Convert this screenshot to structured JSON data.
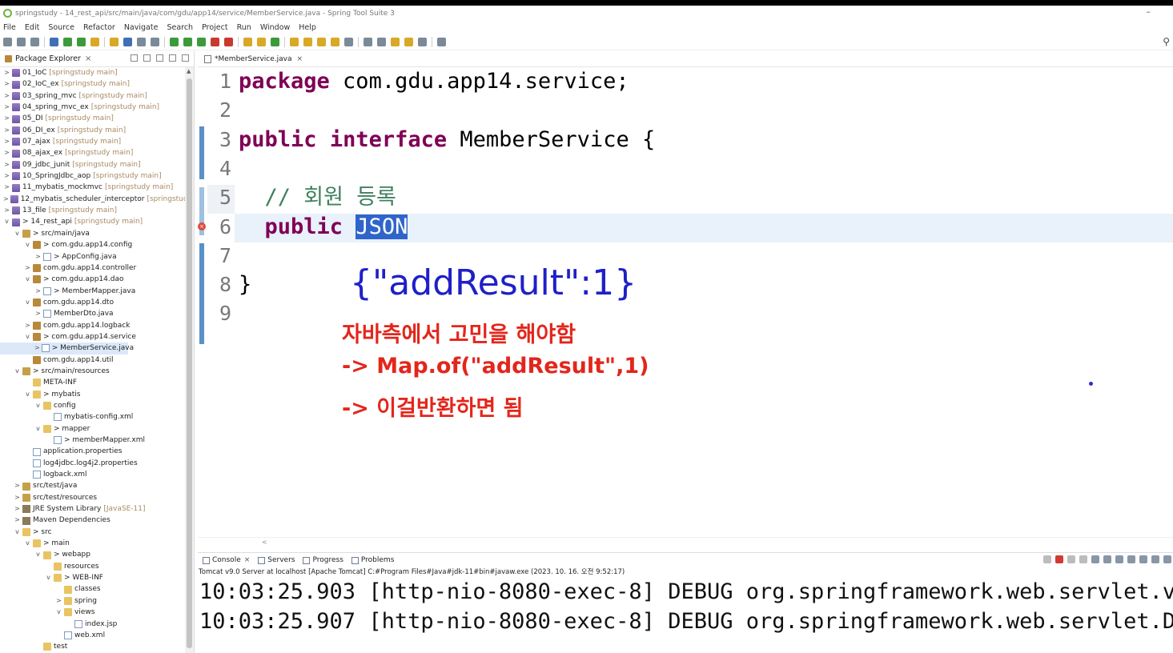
{
  "window": {
    "title": "springstudy - 14_rest_api/src/main/java/com/gdu/app14/service/MemberService.java - Spring Tool Suite 3",
    "minimize": "–"
  },
  "menu": [
    "File",
    "Edit",
    "Source",
    "Refactor",
    "Navigate",
    "Search",
    "Project",
    "Run",
    "Window",
    "Help"
  ],
  "explorer": {
    "title": "Package Explorer",
    "rows": [
      {
        "arrow": ">",
        "icon": "project",
        "label": "01_IoC",
        "suffix": "[springstudy main]",
        "indent": 0
      },
      {
        "arrow": ">",
        "icon": "project",
        "label": "02_IoC_ex",
        "suffix": "[springstudy main]",
        "indent": 0
      },
      {
        "arrow": ">",
        "icon": "project",
        "label": "03_spring_mvc",
        "suffix": "[springstudy main]",
        "indent": 0
      },
      {
        "arrow": ">",
        "icon": "project",
        "label": "04_spring_mvc_ex",
        "suffix": "[springstudy main]",
        "indent": 0
      },
      {
        "arrow": ">",
        "icon": "project",
        "label": "05_DI",
        "suffix": "[springstudy main]",
        "indent": 0
      },
      {
        "arrow": ">",
        "icon": "project",
        "label": "06_DI_ex",
        "suffix": "[springstudy main]",
        "indent": 0
      },
      {
        "arrow": ">",
        "icon": "project",
        "label": "07_ajax",
        "suffix": "[springstudy main]",
        "indent": 0
      },
      {
        "arrow": ">",
        "icon": "project",
        "label": "08_ajax_ex",
        "suffix": "[springstudy main]",
        "indent": 0
      },
      {
        "arrow": ">",
        "icon": "project",
        "label": "09_jdbc_junit",
        "suffix": "[springstudy main]",
        "indent": 0
      },
      {
        "arrow": ">",
        "icon": "project",
        "label": "10_SpringJdbc_aop",
        "suffix": "[springstudy main]",
        "indent": 0
      },
      {
        "arrow": ">",
        "icon": "project",
        "label": "11_mybatis_mockmvc",
        "suffix": "[springstudy main]",
        "indent": 0
      },
      {
        "arrow": ">",
        "icon": "project",
        "label": "12_mybatis_scheduler_interceptor",
        "suffix": "[springstudy",
        "indent": 0
      },
      {
        "arrow": ">",
        "icon": "project",
        "label": "13_file",
        "suffix": "[springstudy main]",
        "indent": 0
      },
      {
        "arrow": "v",
        "icon": "project",
        "label": "> 14_rest_api",
        "suffix": "[springstudy main]",
        "indent": 0
      },
      {
        "arrow": "v",
        "icon": "src",
        "label": "> src/main/java",
        "suffix": "",
        "indent": 1
      },
      {
        "arrow": "v",
        "icon": "pkg",
        "label": "> com.gdu.app14.config",
        "suffix": "",
        "indent": 2
      },
      {
        "arrow": ">",
        "icon": "file",
        "label": "> AppConfig.java",
        "suffix": "",
        "indent": 3
      },
      {
        "arrow": ">",
        "icon": "pkg",
        "label": "com.gdu.app14.controller",
        "suffix": "",
        "indent": 2
      },
      {
        "arrow": "v",
        "icon": "pkg",
        "label": "> com.gdu.app14.dao",
        "suffix": "",
        "indent": 2
      },
      {
        "arrow": ">",
        "icon": "file",
        "label": "> MemberMapper.java",
        "suffix": "",
        "indent": 3
      },
      {
        "arrow": "v",
        "icon": "pkg",
        "label": "com.gdu.app14.dto",
        "suffix": "",
        "indent": 2
      },
      {
        "arrow": ">",
        "icon": "file",
        "label": "MemberDto.java",
        "suffix": "",
        "indent": 3
      },
      {
        "arrow": ">",
        "icon": "pkg",
        "label": "com.gdu.app14.logback",
        "suffix": "",
        "indent": 2
      },
      {
        "arrow": "v",
        "icon": "pkg",
        "label": "> com.gdu.app14.service",
        "suffix": "",
        "indent": 2
      },
      {
        "arrow": ">",
        "icon": "file",
        "label": "> MemberService.java",
        "suffix": "",
        "indent": 3,
        "selected": true
      },
      {
        "arrow": "",
        "icon": "pkg",
        "label": "com.gdu.app14.util",
        "suffix": "",
        "indent": 2
      },
      {
        "arrow": "v",
        "icon": "src",
        "label": "> src/main/resources",
        "suffix": "",
        "indent": 1
      },
      {
        "arrow": "",
        "icon": "folder",
        "label": "META-INF",
        "suffix": "",
        "indent": 2
      },
      {
        "arrow": "v",
        "icon": "folder",
        "label": "> mybatis",
        "suffix": "",
        "indent": 2
      },
      {
        "arrow": "v",
        "icon": "folder",
        "label": "config",
        "suffix": "",
        "indent": 3
      },
      {
        "arrow": "",
        "icon": "file",
        "label": "mybatis-config.xml",
        "suffix": "",
        "indent": 4
      },
      {
        "arrow": "v",
        "icon": "folder",
        "label": "> mapper",
        "suffix": "",
        "indent": 3
      },
      {
        "arrow": "",
        "icon": "file",
        "label": "> memberMapper.xml",
        "suffix": "",
        "indent": 4
      },
      {
        "arrow": "",
        "icon": "file",
        "label": "application.properties",
        "suffix": "",
        "indent": 2
      },
      {
        "arrow": "",
        "icon": "file",
        "label": "log4jdbc.log4j2.properties",
        "suffix": "",
        "indent": 2
      },
      {
        "arrow": "",
        "icon": "file",
        "label": "logback.xml",
        "suffix": "",
        "indent": 2
      },
      {
        "arrow": ">",
        "icon": "src",
        "label": "src/test/java",
        "suffix": "",
        "indent": 1
      },
      {
        "arrow": ">",
        "icon": "src",
        "label": "src/test/resources",
        "suffix": "",
        "indent": 1
      },
      {
        "arrow": ">",
        "icon": "lib",
        "label": "JRE System Library",
        "suffix": "[JavaSE-11]",
        "indent": 1
      },
      {
        "arrow": ">",
        "icon": "lib",
        "label": "Maven Dependencies",
        "suffix": "",
        "indent": 1
      },
      {
        "arrow": "v",
        "icon": "folder",
        "label": "> src",
        "suffix": "",
        "indent": 1
      },
      {
        "arrow": "v",
        "icon": "folder",
        "label": "> main",
        "suffix": "",
        "indent": 2
      },
      {
        "arrow": "v",
        "icon": "folder",
        "label": "> webapp",
        "suffix": "",
        "indent": 3
      },
      {
        "arrow": "",
        "icon": "folder",
        "label": "resources",
        "suffix": "",
        "indent": 4
      },
      {
        "arrow": "v",
        "icon": "folder",
        "label": "> WEB-INF",
        "suffix": "",
        "indent": 4
      },
      {
        "arrow": "",
        "icon": "folder",
        "label": "classes",
        "suffix": "",
        "indent": 5
      },
      {
        "arrow": ">",
        "icon": "folder",
        "label": "spring",
        "suffix": "",
        "indent": 5
      },
      {
        "arrow": "v",
        "icon": "folder",
        "label": "views",
        "suffix": "",
        "indent": 5
      },
      {
        "arrow": "",
        "icon": "file",
        "label": "index.jsp",
        "suffix": "",
        "indent": 6
      },
      {
        "arrow": "",
        "icon": "file",
        "label": "web.xml",
        "suffix": "",
        "indent": 5
      },
      {
        "arrow": "",
        "icon": "folder",
        "label": "test",
        "suffix": "",
        "indent": 3
      }
    ]
  },
  "editor": {
    "tab": "*MemberService.java",
    "lines": [
      {
        "n": "1",
        "parts": [
          {
            "t": "package",
            "c": "kw"
          },
          {
            "t": " com.gdu.app14.service;",
            "c": ""
          }
        ]
      },
      {
        "n": "2",
        "parts": []
      },
      {
        "n": "3",
        "parts": [
          {
            "t": "public",
            "c": "kw"
          },
          {
            "t": " ",
            "c": ""
          },
          {
            "t": "interface",
            "c": "kw"
          },
          {
            "t": " MemberService {",
            "c": ""
          }
        ]
      },
      {
        "n": "4",
        "parts": []
      },
      {
        "n": "5",
        "parts": [
          {
            "t": "  ",
            "c": ""
          },
          {
            "t": "// 회원 등록",
            "c": "cm"
          }
        ]
      },
      {
        "n": "6",
        "parts": [
          {
            "t": "  ",
            "c": ""
          },
          {
            "t": "public",
            "c": "kw"
          },
          {
            "t": " ",
            "c": ""
          },
          {
            "t": "JSON",
            "c": "sel"
          }
        ]
      },
      {
        "n": "7",
        "parts": []
      },
      {
        "n": "8",
        "parts": [
          {
            "t": "}",
            "c": ""
          }
        ]
      },
      {
        "n": "9",
        "parts": []
      }
    ],
    "annotation_json": "{\"addResult\":1}",
    "annotations": [
      "자바측에서 고민을 해야함",
      "-> Map.of(\"addResult\",1)",
      "-> 이걸반환하면 됨"
    ]
  },
  "console": {
    "tabs": [
      "Console",
      "Servers",
      "Progress",
      "Problems"
    ],
    "info": "Tomcat v9.0 Server at localhost [Apache Tomcat] C:#Program Files#Java#jdk-11#bin#javaw.exe  (2023. 10. 16. 오전 9:52:17)",
    "lines": [
      "10:03:25.903 [http-nio-8080-exec-8] DEBUG org.springframework.web.servlet.view",
      "10:03:25.907 [http-nio-8080-exec-8] DEBUG org.springframework.web.servlet.Dis"
    ]
  },
  "colors": {
    "keyword": "#7f0055",
    "comment": "#3f7f5f",
    "annotation_blue": "#1f1fc8",
    "annotation_red": "#e3261b",
    "selection": "#2f65ca"
  }
}
